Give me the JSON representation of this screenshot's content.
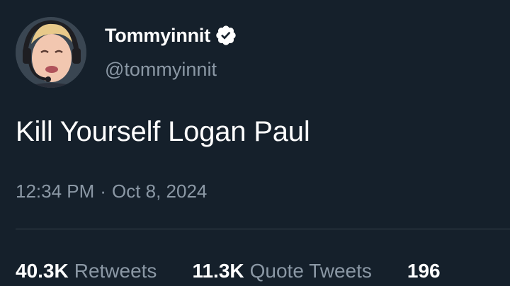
{
  "tweet": {
    "author": {
      "display_name": "Tommyinnit",
      "handle": "@tommyinnit",
      "verified": true,
      "avatar_icon": "user-avatar"
    },
    "text": "Kill Yourself Logan Paul",
    "time": "12:34 PM",
    "separator": "·",
    "date": "Oct 8, 2024",
    "stats": [
      {
        "count": "40.3K",
        "label": "Retweets"
      },
      {
        "count": "11.3K",
        "label": "Quote Tweets"
      },
      {
        "count": "196",
        "label": ""
      }
    ]
  },
  "colors": {
    "background": "#15202b",
    "primary_text": "#ffffff",
    "secondary_text": "#8b98a5",
    "divider": "#38444d",
    "verified_badge": "#ffffff"
  }
}
